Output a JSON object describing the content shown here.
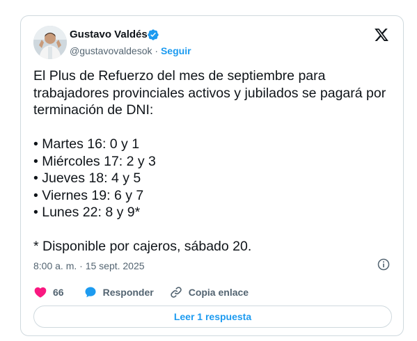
{
  "author": {
    "name": "Gustavo Valdés",
    "handle": "@gustavovaldesok",
    "separator": " · ",
    "follow_label": "Seguir",
    "avatar_icon": "avatar-photo",
    "verified_icon": "verified-badge-icon"
  },
  "tweet": {
    "text": "El Plus de Refuerzo del mes de septiembre para trabajadores provinciales activos y jubilados se pagará por terminación de DNI:\n\n• Martes 16: 0 y 1\n• Miércoles 17: 2 y 3\n• Jueves 18: 4 y 5\n• Viernes 19: 6 y 7\n• Lunes 22: 8 y 9*\n\n* Disponible por cajeros, sábado 20.",
    "timestamp": "8:00 a. m. · 15 sept. 2025"
  },
  "actions": {
    "like_count": "66",
    "reply_label": "Responder",
    "copy_label": "Copia enlace"
  },
  "footer": {
    "read_replies_label": "Leer 1 respuesta"
  },
  "colors": {
    "accent": "#1d9bf0",
    "like": "#f91880",
    "text": "#0f1419",
    "muted": "#536471",
    "border": "#cfd9de"
  }
}
